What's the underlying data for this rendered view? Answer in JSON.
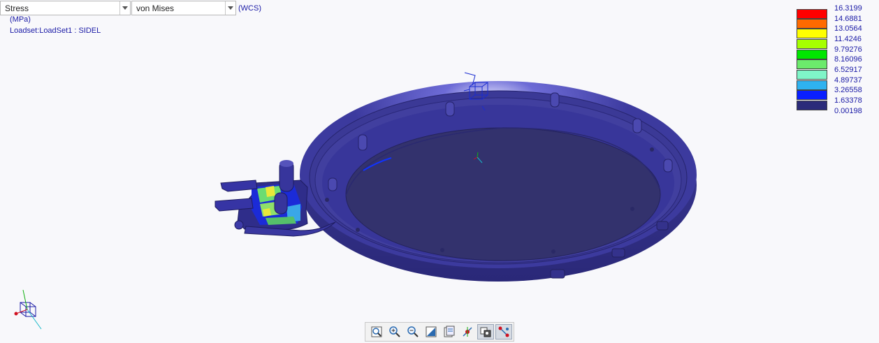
{
  "toolbar_top": {
    "result_type": "Stress",
    "component": "von Mises",
    "coord_system": "(WCS)"
  },
  "info": {
    "units": "(MPa)",
    "loadset": "Loadset:LoadSet1 :  SIDEL"
  },
  "legend": {
    "values": [
      "16.3199",
      "14.6881",
      "13.0564",
      "11.4246",
      "9.79276",
      "8.16096",
      "6.52917",
      "4.89737",
      "3.26558",
      "1.63378",
      "0.00198"
    ],
    "colors": [
      "#ff0000",
      "#ff6a00",
      "#ffff00",
      "#a6ff00",
      "#00e600",
      "#6cea6c",
      "#7ff5c8",
      "#2fb2f0",
      "#0a1fff",
      "#2b2b7a"
    ]
  },
  "view_toolbar": {
    "tools": [
      {
        "icon": "refit-icon",
        "active": false
      },
      {
        "icon": "zoom-in-icon",
        "active": false
      },
      {
        "icon": "zoom-out-icon",
        "active": false
      },
      {
        "icon": "repaint-icon",
        "active": false
      },
      {
        "icon": "saved-views-icon",
        "active": false
      },
      {
        "icon": "spin-center-icon",
        "active": false
      },
      {
        "icon": "display-style-icon",
        "active": true
      },
      {
        "icon": "datum-display-icon",
        "active": true
      }
    ]
  }
}
